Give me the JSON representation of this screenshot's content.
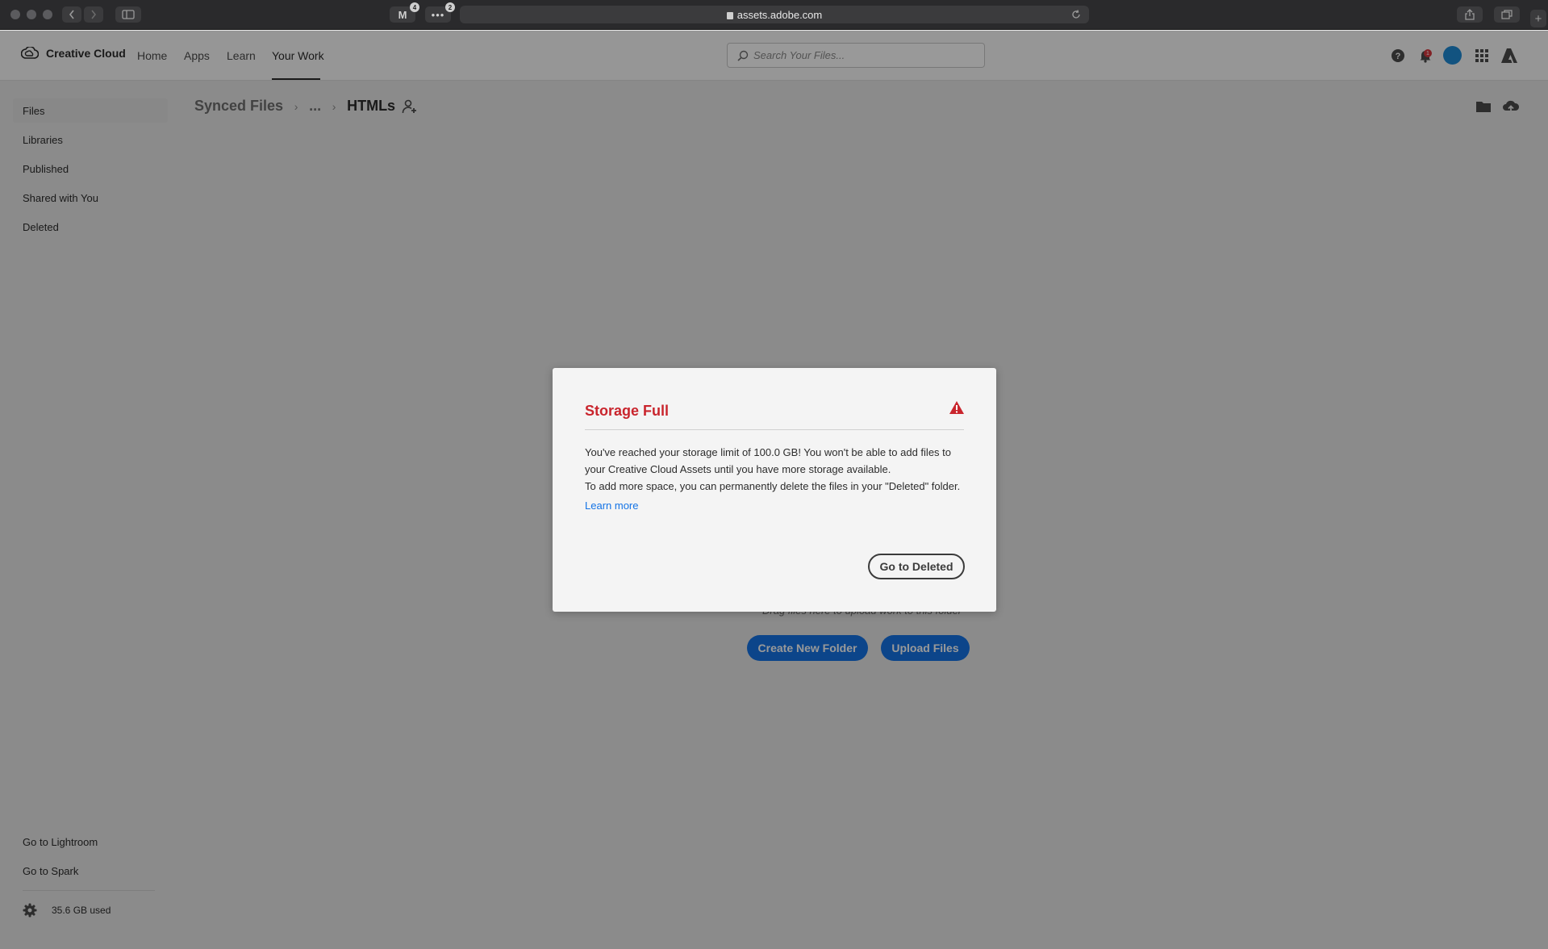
{
  "browser": {
    "url": "assets.adobe.com",
    "tab_badges": [
      "4",
      "2"
    ]
  },
  "header": {
    "brand": "Creative Cloud",
    "nav": [
      "Home",
      "Apps",
      "Learn",
      "Your Work"
    ],
    "active_nav": "Your Work",
    "search_placeholder": "Search Your Files...",
    "notification_count": "1",
    "accent_color": "#1473e6"
  },
  "sidebar": {
    "items": [
      "Files",
      "Libraries",
      "Published",
      "Shared with You",
      "Deleted"
    ],
    "selected": "Files",
    "links": [
      "Go to Lightroom",
      "Go to Spark"
    ],
    "storage_used": "35.6 GB used"
  },
  "main": {
    "breadcrumb": [
      "Synced Files",
      "...",
      "HTMLs"
    ],
    "empty_hint": "Drag files here to upload work to this folder",
    "create_folder_label": "Create New Folder",
    "upload_label": "Upload Files"
  },
  "modal": {
    "title": "Storage Full",
    "title_color": "#c9252d",
    "body_lines": [
      "You've reached your storage limit of 100.0 GB! You won't be able to add files to",
      "your Creative Cloud Assets until you have more storage available.",
      "To add more space, you can permanently delete the files in your \"Deleted\" folder."
    ],
    "learn_more": "Learn more",
    "action_label": "Go to Deleted"
  }
}
